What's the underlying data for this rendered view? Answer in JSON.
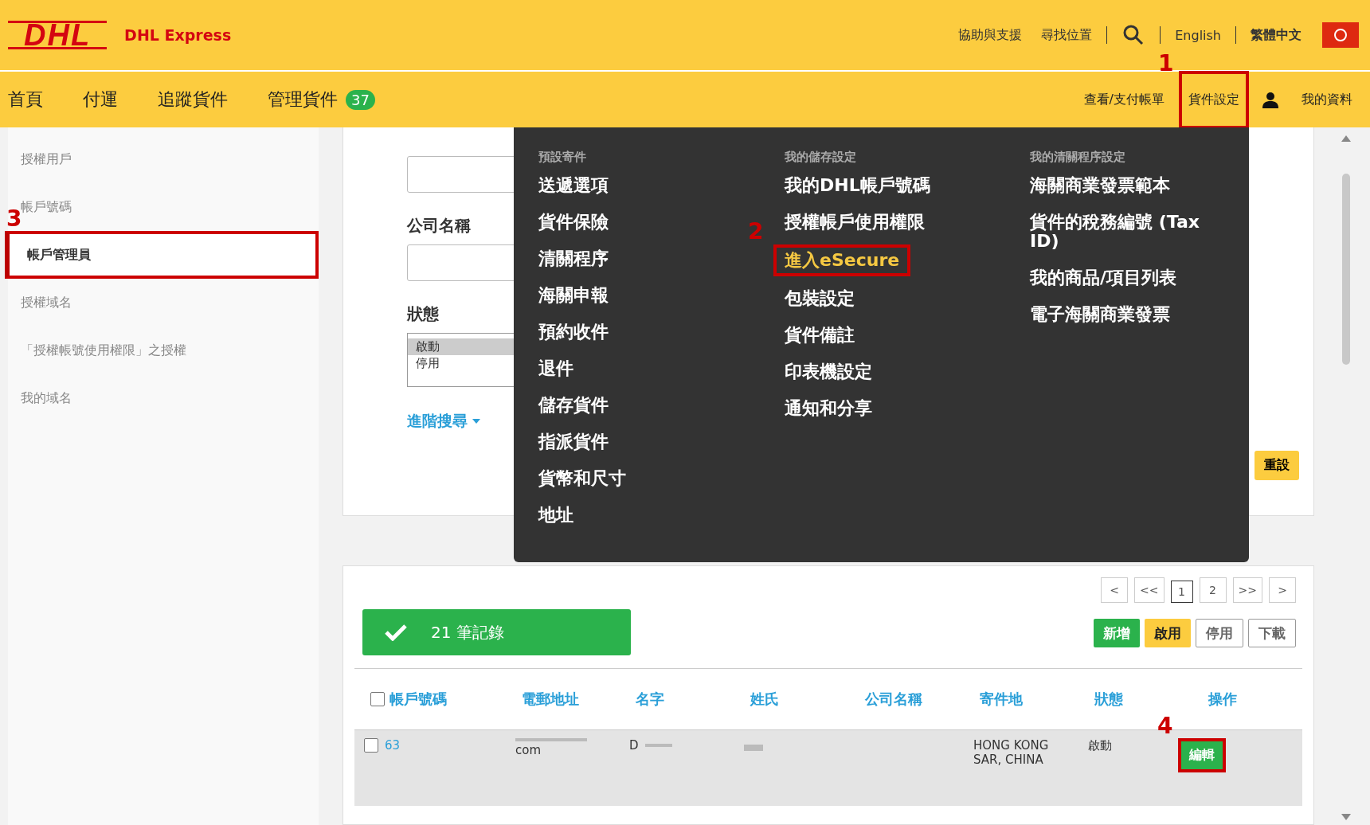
{
  "header": {
    "logo": "DHL",
    "brand": "DHL Express",
    "links": [
      "協助與支援",
      "尋找位置"
    ],
    "languages": [
      {
        "label": "English",
        "selected": false
      },
      {
        "label": "繁體中文",
        "selected": true
      }
    ]
  },
  "nav": {
    "items": [
      {
        "label": "首頁"
      },
      {
        "label": "付運"
      },
      {
        "label": "追蹤貨件"
      },
      {
        "label": "管理貨件",
        "badge": "37"
      }
    ],
    "right": [
      {
        "label": "查看/支付帳單",
        "highlight": false
      },
      {
        "label": "貨件設定",
        "highlight": true,
        "callout": "1"
      }
    ],
    "profile": "我的資料"
  },
  "sidebar": {
    "items": [
      {
        "label": "授權用戶",
        "selected": false
      },
      {
        "label": "帳戶號碼",
        "selected": false
      },
      {
        "label": "帳戶管理員",
        "selected": true,
        "callout": "3"
      },
      {
        "label": "授權域名",
        "selected": false
      },
      {
        "label": "「授權帳號使用權限」之授權",
        "selected": false
      },
      {
        "label": "我的域名",
        "selected": false
      }
    ]
  },
  "filters": {
    "company_label": "公司名稱",
    "status_label": "狀態",
    "status_options": [
      {
        "label": "啟動",
        "selected": true
      },
      {
        "label": "停用",
        "selected": false
      }
    ],
    "advanced": "進階搜尋",
    "reset": "重設"
  },
  "menu": {
    "columns": [
      {
        "title": "預設寄件",
        "items": [
          {
            "label": "送遞選項"
          },
          {
            "label": "貨件保險"
          },
          {
            "label": "清關程序"
          },
          {
            "label": "海關申報"
          },
          {
            "label": "預約收件"
          },
          {
            "label": "退件"
          },
          {
            "label": "儲存貨件"
          },
          {
            "label": "指派貨件"
          },
          {
            "label": "貨幣和尺寸"
          },
          {
            "label": "地址"
          }
        ]
      },
      {
        "title": "我的儲存設定",
        "items": [
          {
            "label": "我的DHL帳戶號碼"
          },
          {
            "label": "授權帳戶使用權限"
          },
          {
            "label": "進入eSecure",
            "hover": true,
            "callout": "2"
          },
          {
            "label": "包裝設定"
          },
          {
            "label": "貨件備註"
          },
          {
            "label": "印表機設定"
          },
          {
            "label": "通知和分享"
          }
        ]
      },
      {
        "title": "我的清關程序設定",
        "items": [
          {
            "label": "海關商業發票範本"
          },
          {
            "label": "貨件的稅務編號 (Tax ID)"
          },
          {
            "label": "我的商品/項目列表"
          },
          {
            "label": "電子海關商業發票"
          }
        ]
      }
    ]
  },
  "pagination": [
    {
      "label": "<",
      "selected": false
    },
    {
      "label": "<<",
      "selected": false
    },
    {
      "label": "1",
      "selected": true
    },
    {
      "label": "2",
      "selected": false
    },
    {
      "label": ">>",
      "selected": false
    },
    {
      "label": ">",
      "selected": false
    }
  ],
  "records": "21 筆記錄",
  "actions": [
    {
      "label": "新增",
      "kind": "green"
    },
    {
      "label": "啟用",
      "kind": "yellow"
    },
    {
      "label": "停用",
      "kind": "plain"
    },
    {
      "label": "下載",
      "kind": "plain"
    }
  ],
  "table": {
    "select_all_checked": false,
    "columns": [
      "帳戶號碼",
      "電郵地址",
      "名字",
      "姓氏",
      "公司名稱",
      "寄件地",
      "狀態",
      "操作"
    ],
    "rows": [
      {
        "checked": false,
        "account": "63",
        "email": "com",
        "first_name": "D",
        "origin": "HONG KONG SAR, CHINA",
        "status": "啟動",
        "action": "編輯",
        "callout": "4"
      }
    ]
  }
}
